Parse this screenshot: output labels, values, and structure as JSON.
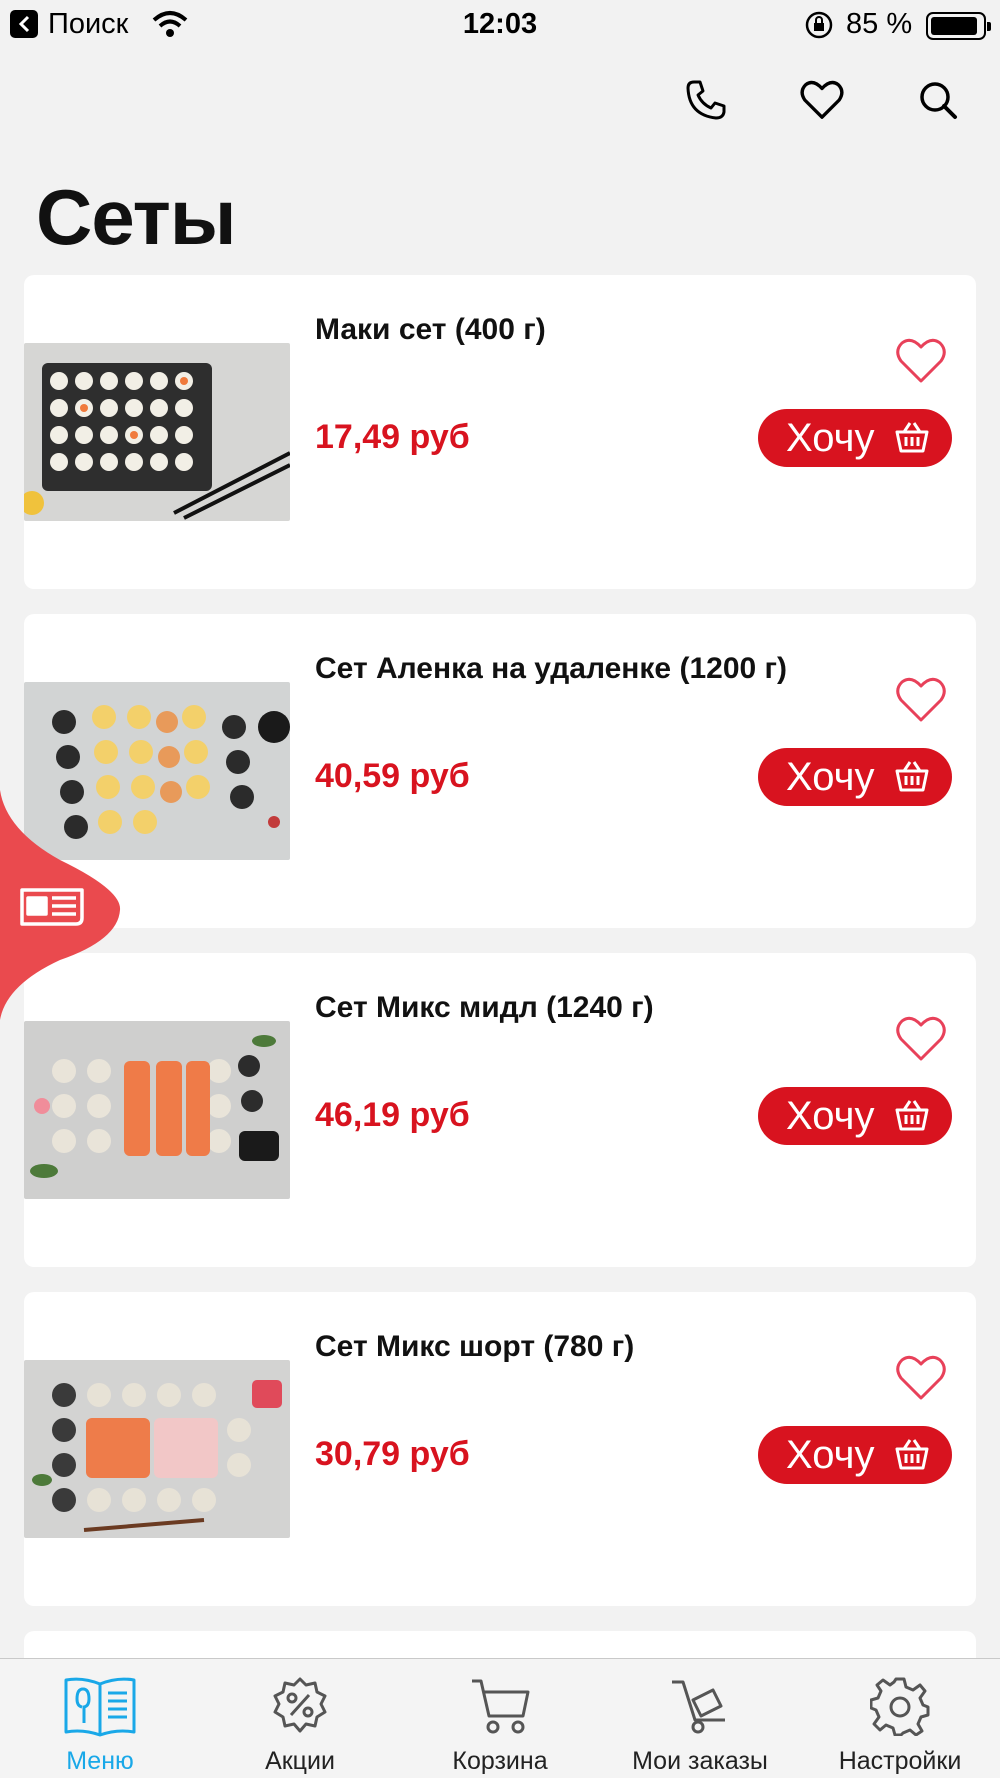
{
  "status_bar": {
    "back_label": "Поиск",
    "time": "12:03",
    "battery": "85 %"
  },
  "header": {
    "title": "Сеты",
    "icons": [
      "phone-icon",
      "heart-icon",
      "search-icon"
    ]
  },
  "products": [
    {
      "name": "Маки сет (400 г)",
      "price": "17,49 руб",
      "button": "Хочу"
    },
    {
      "name": "Сет Аленка на удаленке (1200 г)",
      "price": "40,59 руб",
      "button": "Хочу"
    },
    {
      "name": "Сет Микс мидл (1240 г)",
      "price": "46,19 руб",
      "button": "Хочу"
    },
    {
      "name": "Сет Микс шорт (780 г)",
      "price": "30,79 руб",
      "button": "Хочу"
    }
  ],
  "tabbar": {
    "items": [
      {
        "label": "Меню",
        "icon": "menu-book-icon",
        "active": true
      },
      {
        "label": "Акции",
        "icon": "percent-gear-icon",
        "active": false
      },
      {
        "label": "Корзина",
        "icon": "cart-icon",
        "active": false
      },
      {
        "label": "Мои заказы",
        "icon": "trolley-icon",
        "active": false
      },
      {
        "label": "Настройки",
        "icon": "gear-icon",
        "active": false
      }
    ]
  },
  "colors": {
    "accent": "#d8131f",
    "active_tab": "#19a8e8",
    "heart": "#e8415a",
    "background": "#f2f2f2"
  }
}
